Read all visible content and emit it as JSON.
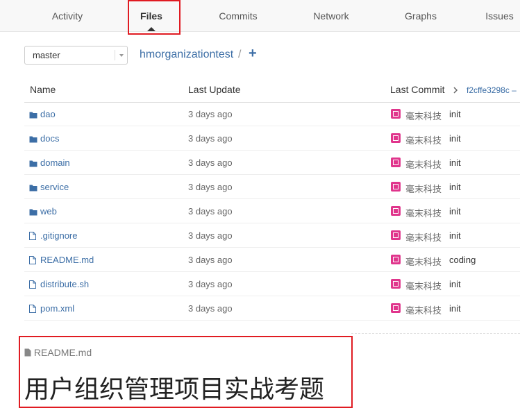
{
  "tabs": [
    {
      "label": "Activity"
    },
    {
      "label": "Files"
    },
    {
      "label": "Commits"
    },
    {
      "label": "Network"
    },
    {
      "label": "Graphs"
    },
    {
      "label": "Issues"
    }
  ],
  "branch": {
    "selected": "master"
  },
  "breadcrumb": {
    "repo": "hmorganizationtest",
    "separator": "/",
    "add": "+"
  },
  "table": {
    "headers": {
      "name": "Name",
      "last_update": "Last Update",
      "last_commit": "Last Commit",
      "commit_sha": "f2cffe3298c –"
    },
    "rows": [
      {
        "name": "dao",
        "type": "folder",
        "updated": "3 days ago",
        "author": "毫末科技",
        "message": "init"
      },
      {
        "name": "docs",
        "type": "folder",
        "updated": "3 days ago",
        "author": "毫末科技",
        "message": "init"
      },
      {
        "name": "domain",
        "type": "folder",
        "updated": "3 days ago",
        "author": "毫末科技",
        "message": "init"
      },
      {
        "name": "service",
        "type": "folder",
        "updated": "3 days ago",
        "author": "毫末科技",
        "message": "init"
      },
      {
        "name": "web",
        "type": "folder",
        "updated": "3 days ago",
        "author": "毫末科技",
        "message": "init"
      },
      {
        "name": ".gitignore",
        "type": "file",
        "updated": "3 days ago",
        "author": "毫末科技",
        "message": "init"
      },
      {
        "name": "README.md",
        "type": "file",
        "updated": "3 days ago",
        "author": "毫末科技",
        "message": "coding"
      },
      {
        "name": "distribute.sh",
        "type": "file",
        "updated": "3 days ago",
        "author": "毫末科技",
        "message": "init"
      },
      {
        "name": "pom.xml",
        "type": "file",
        "updated": "3 days ago",
        "author": "毫末科技",
        "message": "init"
      }
    ]
  },
  "readme": {
    "filename": "README.md",
    "title": "用户组织管理项目实战考题"
  },
  "colors": {
    "link": "#3c6ea6",
    "highlight": "#e01b22",
    "avatar": "#e0358c"
  }
}
